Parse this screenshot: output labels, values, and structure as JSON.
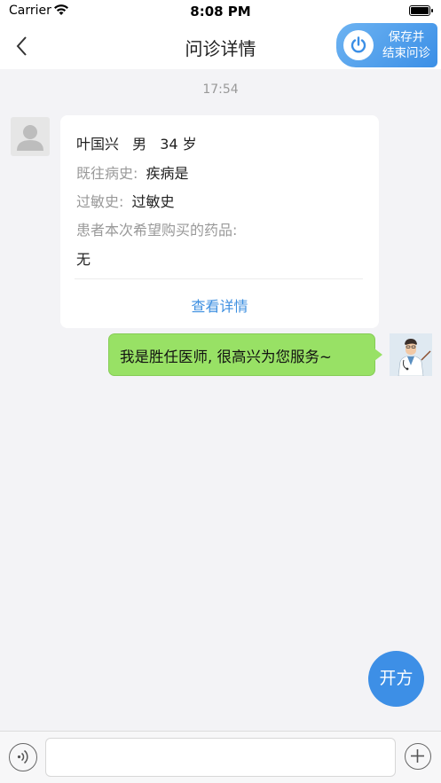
{
  "status_bar": {
    "carrier": "Carrier",
    "time": "8:08 PM",
    "icons": [
      "wifi-icon",
      "battery-icon"
    ]
  },
  "nav": {
    "title": "问诊详情",
    "back_icon": "chevron-left-icon",
    "end_consult_line1": "保存并",
    "end_consult_line2": "结束问诊",
    "end_consult_icon": "power-icon",
    "accent_color": "#3b8fe6"
  },
  "chat": {
    "timestamp": "17:54",
    "patient_card": {
      "name": "叶国兴",
      "gender": "男",
      "age": "34 岁",
      "history_label": "既往病史:",
      "history_value": "疾病是",
      "allergy_label": "过敏史:",
      "allergy_value": "过敏史",
      "medicine_label": "患者本次希望购买的药品:",
      "medicine_value": "无",
      "view_details": "查看详情"
    },
    "doctor_message": "我是胜任医师, 很高兴为您服务~",
    "bubble_color": "#98e165"
  },
  "prescribe_button": "开方",
  "input_bar": {
    "message_value": "",
    "message_placeholder": "",
    "voice_icon": "voice-icon",
    "add_icon": "plus-icon"
  }
}
